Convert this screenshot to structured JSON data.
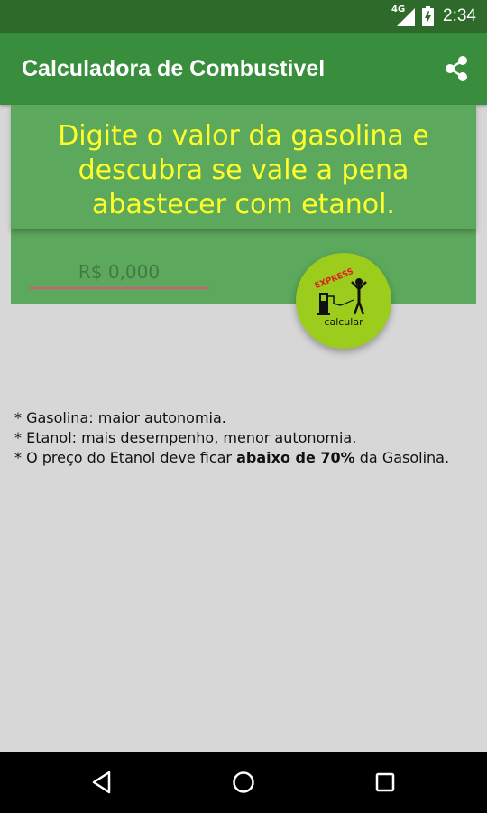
{
  "status_bar": {
    "network": "4G",
    "time": "2:34"
  },
  "app_bar": {
    "title": "Calculadora de Combustivel",
    "share_icon": "share-icon"
  },
  "card": {
    "headline": "Digite o valor da gasolina e descubra se vale a pena abastecer com etanol.",
    "price_input": {
      "value": "",
      "placeholder": "R$ 0,000"
    }
  },
  "fab": {
    "badge": "EXPRESS",
    "label": "calcular",
    "icon": "fuel-pump-person-icon"
  },
  "notes": {
    "line1": "* Gasolina: maior autonomia.",
    "line2": "* Etanol: mais desempenho, menor autonomia.",
    "line3_prefix": "* O preço do Etanol deve ficar ",
    "line3_bold": "abaixo de 70%",
    "line3_suffix": " da Gasolina."
  },
  "nav_bar": {
    "back_icon": "back-triangle-icon",
    "home_icon": "home-circle-icon",
    "recents_icon": "recents-square-icon"
  },
  "colors": {
    "status_bar": "#2e6b2a",
    "app_bar": "#388e3c",
    "card": "#5ca85c",
    "headline_text": "#ffff2a",
    "input_underline": "#e2507c",
    "fab": "#9ccc1c",
    "background": "#d7d7d7"
  }
}
